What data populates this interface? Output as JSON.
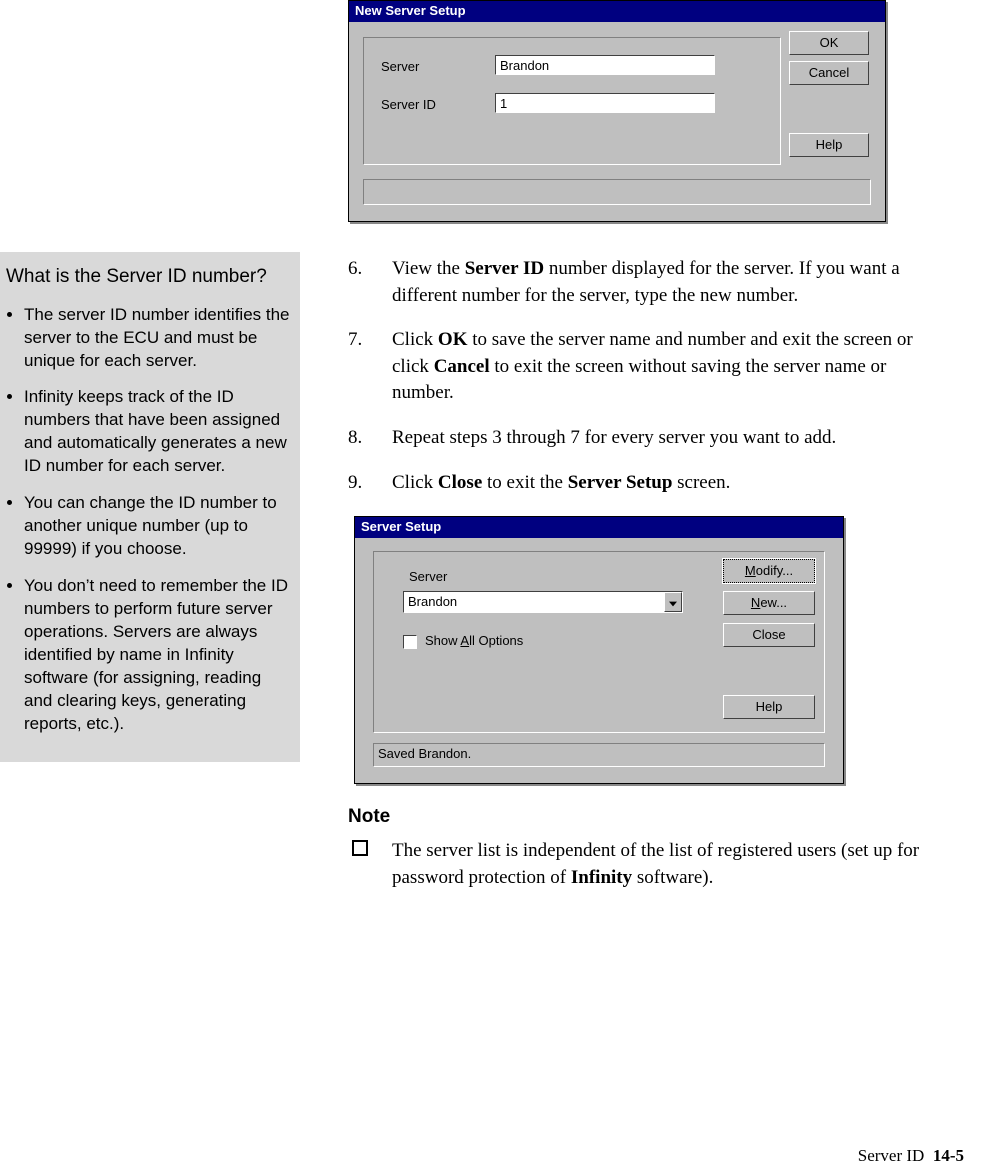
{
  "dialog1": {
    "title": "New Server Setup",
    "server_label": "Server",
    "server_id_label": "Server ID",
    "server_value": "Brandon",
    "server_id_value": "1",
    "ok_label": "OK",
    "cancel_label": "Cancel",
    "help_label": "Help"
  },
  "sidebar": {
    "question": "What is the Server ID number?",
    "items": [
      "The server ID number identifies the server to the ECU and must be unique for each server.",
      "Infinity keeps track of the ID numbers that have been assigned and automatically generates a new ID number for each server.",
      "You can change the ID number to another unique number (up to 99999) if you choose.",
      "You don’t need to remember the ID numbers to perform future server operations. Servers are always identified by name in Infinity software (for assigning, reading and clearing keys, generating reports, etc.)."
    ]
  },
  "steps": {
    "s6_num": "6.",
    "s6_a": "View the ",
    "s6_b": "Server ID",
    "s6_c": " number displayed for the server. If you want a different number for the server,  type the new number.",
    "s7_num": "7.",
    "s7_a": "Click ",
    "s7_b": "OK",
    "s7_c": " to save the server name and number and exit the screen or click ",
    "s7_d": "Cancel",
    "s7_e": " to exit the screen without saving the server name or number.",
    "s8_num": "8.",
    "s8": "Repeat steps 3 through 7 for every server you want to add.",
    "s9_num": "9.",
    "s9_a": "Click ",
    "s9_b": "Close",
    "s9_c": " to exit the ",
    "s9_d": "Server Setup",
    "s9_e": " screen."
  },
  "dialog2": {
    "title": "Server Setup",
    "server_label": "Server",
    "server_value": "Brandon",
    "show_all_pre": "Show ",
    "show_all_u": "A",
    "show_all_post": "ll Options",
    "modify_u": "M",
    "modify_post": "odify...",
    "new_u": "N",
    "new_post": "ew...",
    "close_label": "Close",
    "help_label": "Help",
    "status": "Saved Brandon."
  },
  "note": {
    "heading": "Note",
    "text_a": "The server list is independent of the list of registered users (set up for password protection of ",
    "text_b": "Infinity",
    "text_c": " software)."
  },
  "footer": {
    "section": "Server ID",
    "page": "14-5"
  }
}
